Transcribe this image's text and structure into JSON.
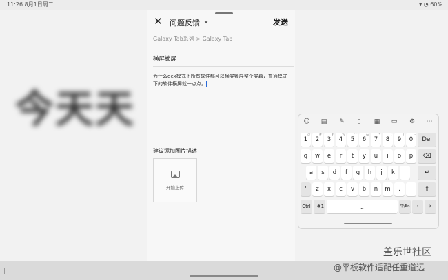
{
  "status_bar": {
    "time_date": "11:26  8月1日周二",
    "battery": "60%"
  },
  "background": {
    "blurred_text": "今天天"
  },
  "panel": {
    "title": "问题反馈",
    "send_label": "发送",
    "breadcrumb": "Galaxy Tab系列 > Galaxy Tab",
    "subject": "横屏锁屏",
    "body": "为什么dex模式下所有软件都可以横屏锁屏整个屏幕，普通模式下的软件横屏就一点点。",
    "attach_label": "建议添加图片描述",
    "upload_label": "开始上传"
  },
  "keyboard": {
    "tools": [
      "emoji",
      "keyboard",
      "handwriting",
      "clipboard",
      "calculator",
      "sticker",
      "settings",
      "more"
    ],
    "row_numbers": [
      "1",
      "2",
      "3",
      "4",
      "5",
      "6",
      "7",
      "8",
      "9",
      "0"
    ],
    "row_numbers_sup": [
      "@",
      "#",
      "¥",
      "%",
      "^",
      "&",
      "*",
      "(",
      ")",
      "-"
    ],
    "row1": [
      "q",
      "w",
      "e",
      "r",
      "t",
      "y",
      "u",
      "i",
      "o",
      "p"
    ],
    "row2": [
      "a",
      "s",
      "d",
      "f",
      "g",
      "h",
      "j",
      "k",
      "l"
    ],
    "row3": [
      "z",
      "x",
      "c",
      "v",
      "b",
      "n",
      "m"
    ],
    "del": "Del",
    "ctrl": "Ctrl",
    "sym": "!#1",
    "lang": "中/En"
  },
  "watermark": {
    "line1": "盖乐世社区",
    "line2": "@平板软件适配任重道远"
  }
}
